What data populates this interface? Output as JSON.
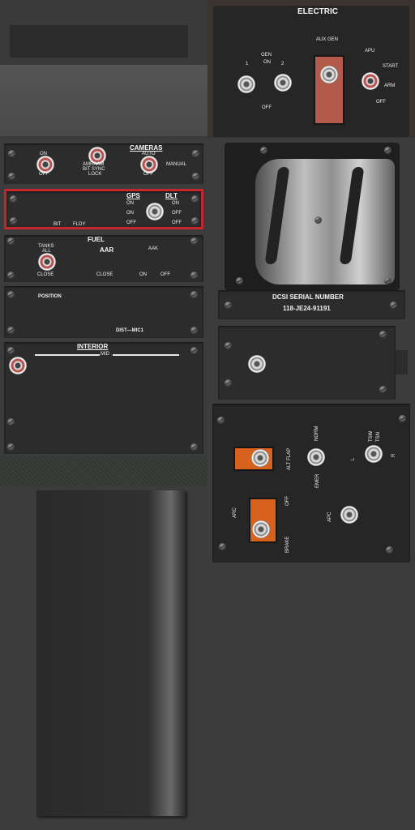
{
  "electric": {
    "title": "ELECTRIC",
    "gen": "GEN",
    "gen_on": "ON",
    "gen_1": "1",
    "gen_2": "2",
    "gen_off": "OFF",
    "aux_gen": "AUX GEN",
    "apu": "APU",
    "apu_start": "START",
    "apu_arm": "ARM",
    "apu_off": "OFF"
  },
  "cameras": {
    "title": "CAMERAS",
    "on": "ON",
    "off": "OFF",
    "auto": "AUTO",
    "amraam": "AMRAAM",
    "bit_sync": "BIT SYNC",
    "lock": "LOCK",
    "off2": "OFF",
    "manual": "MANUAL"
  },
  "gps_dlt": {
    "gps": "GPS",
    "dlt": "DLT",
    "on_left_1": "ON",
    "on_left_2": "ON",
    "off_left": "OFF",
    "on_right": "ON",
    "off_right_1": "OFF",
    "off_right_2": "OFF",
    "bit": "BIT",
    "fldy": "FLDY"
  },
  "fuel": {
    "title": "FUEL",
    "tanks": "TANKS",
    "all": "ALL",
    "close": "CLOSE",
    "aar": "AAR",
    "aak": "AAK",
    "close2": "CLOSE",
    "on": "ON",
    "off": "OFF"
  },
  "position": {
    "title": "POSITION",
    "dist_mic": "DIST—MIC1"
  },
  "interior": {
    "title": "INTERIOR",
    "mid": "MID"
  },
  "dcsi": {
    "title": "DCSI SERIAL NUMBER",
    "serial": "118-JE24-91191"
  },
  "flaps": {
    "alt_flap": "ALT FLAP",
    "norm": "NORM",
    "emer": "EMER",
    "tsw": "TSW",
    "tsn": "TSN",
    "l": "L",
    "r": "R",
    "arc": "ARC",
    "off": "OFF",
    "brake": "BRAKE",
    "apc": "APC"
  },
  "colors": {
    "gps_border": "#c8262c",
    "guard_orange": "#d7621e",
    "aux_guard": "#b35a4c"
  }
}
